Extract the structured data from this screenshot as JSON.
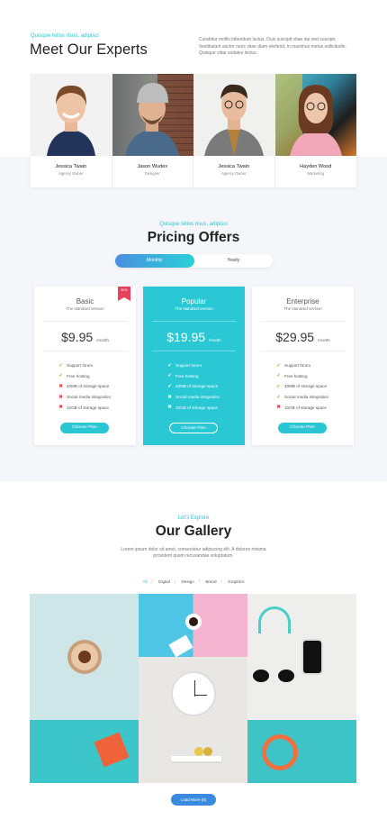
{
  "experts": {
    "eyebrow": "Quisque tellus risus, adipisci",
    "title": "Meet Our Experts",
    "description": "Curabitur mollis bibendum luctus. Duis suscipit vitae dui sed suscipit. Vestibulum auctor nunc vitae diam eleifend, in maximus metus sollicitudin. Quisque vitae sodales lectus.",
    "members": [
      {
        "name": "Jessica Twain",
        "role": "Agency Owner"
      },
      {
        "name": "Jason Wudex",
        "role": "Designer"
      },
      {
        "name": "Jessica Twain",
        "role": "Agency Owner"
      },
      {
        "name": "Hayden Wood",
        "role": "Marketing"
      }
    ]
  },
  "pricing": {
    "eyebrow": "Quisque tellus risus, adipisci",
    "title": "Pricing Offers",
    "toggle": {
      "monthly": "Monthly",
      "yearly": "Yearly"
    },
    "plans": [
      {
        "name": "Basic",
        "subtitle": "The standard version",
        "price": "$9.95",
        "period": "/month",
        "ribbon": "50%",
        "features": [
          {
            "label": "Support forum",
            "included": true
          },
          {
            "label": "Free hosting",
            "included": true
          },
          {
            "label": "40MB of storage space",
            "included": false
          },
          {
            "label": "Social media integration",
            "included": false
          },
          {
            "label": "10GB of storage space",
            "included": false
          }
        ],
        "button": "Choose Plan"
      },
      {
        "name": "Popular",
        "subtitle": "The standard version",
        "price": "$19.95",
        "period": "/month",
        "features": [
          {
            "label": "Support forum",
            "included": true
          },
          {
            "label": "Free hosting",
            "included": true
          },
          {
            "label": "40MB of storage space",
            "included": true
          },
          {
            "label": "Social media integration",
            "included": false
          },
          {
            "label": "10GB of storage space",
            "included": false
          }
        ],
        "button": "Choose Plan"
      },
      {
        "name": "Enterprise",
        "subtitle": "The standard version",
        "price": "$29.95",
        "period": "/month",
        "features": [
          {
            "label": "Support forum",
            "included": true
          },
          {
            "label": "Free hosting",
            "included": true
          },
          {
            "label": "40MB of storage space",
            "included": true
          },
          {
            "label": "Social media integration",
            "included": true
          },
          {
            "label": "10GB of storage space",
            "included": false
          }
        ],
        "button": "Choose Plan"
      }
    ]
  },
  "gallery": {
    "eyebrow": "Let's Explore",
    "title": "Our Gallery",
    "description": "Lorem ipsum dolor sit amet, consectetur adipiscing elit. A dolores minima provident quam recusandae voluptatum.",
    "filters": [
      "All",
      "Digital",
      "Design",
      "Brand",
      "Graphics"
    ],
    "load_more": "Load More (8)"
  },
  "colors": {
    "accent": "#2ac6d4",
    "ribbon": "#e9415c",
    "check": "#8cc63f",
    "cross": "#e33333"
  }
}
